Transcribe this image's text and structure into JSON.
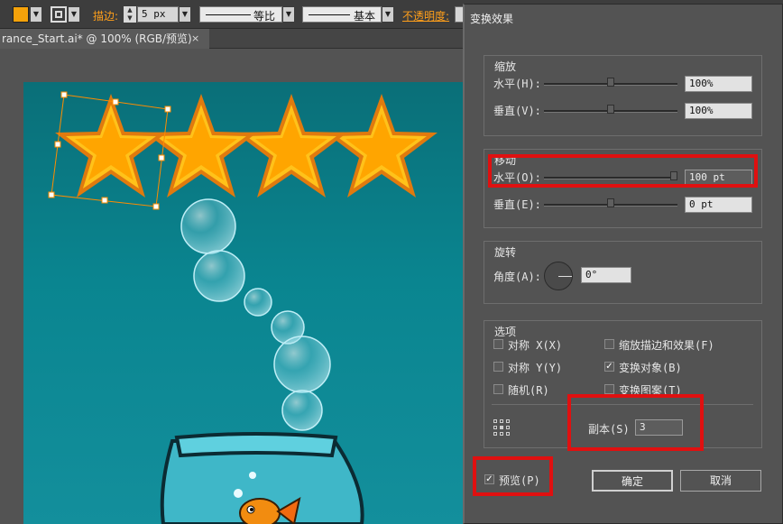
{
  "control_bar": {
    "stroke_label": "描边:",
    "stroke_width": "5 px",
    "profile_uniform": "等比",
    "brush_basic": "基本",
    "opacity_label": "不透明度:",
    "fill_color": "#f5a20a"
  },
  "document_tab": {
    "title": "rance_Start.ai* @ 100% (RGB/预览)",
    "close": "×"
  },
  "dialog": {
    "title": "变换效果",
    "scale": {
      "legend": "缩放",
      "horizontal_label": "水平(H):",
      "horizontal_value": "100%",
      "vertical_label": "垂直(V):",
      "vertical_value": "100%"
    },
    "move": {
      "legend": "移动",
      "horizontal_label": "水平(O):",
      "horizontal_value": "100 pt",
      "vertical_label": "垂直(E):",
      "vertical_value": "0 pt"
    },
    "rotate": {
      "legend": "旋转",
      "angle_label": "角度(A):",
      "angle_value": "0°"
    },
    "options": {
      "legend": "选项",
      "reflect_x": {
        "label": "对称 X(X)",
        "checked": false
      },
      "reflect_y": {
        "label": "对称 Y(Y)",
        "checked": false
      },
      "random": {
        "label": "随机(R)",
        "checked": false
      },
      "scale_strokes": {
        "label": "缩放描边和效果(F)",
        "checked": false
      },
      "transform_objects": {
        "label": "变换对象(B)",
        "checked": true
      },
      "transform_patterns": {
        "label": "变换图案(T)",
        "checked": false
      },
      "copies_label": "副本(S)",
      "copies_value": "3"
    },
    "preview": {
      "label": "预览(P)",
      "checked": true
    },
    "ok_label": "确定",
    "cancel_label": "取消",
    "check_mark": "✓"
  }
}
